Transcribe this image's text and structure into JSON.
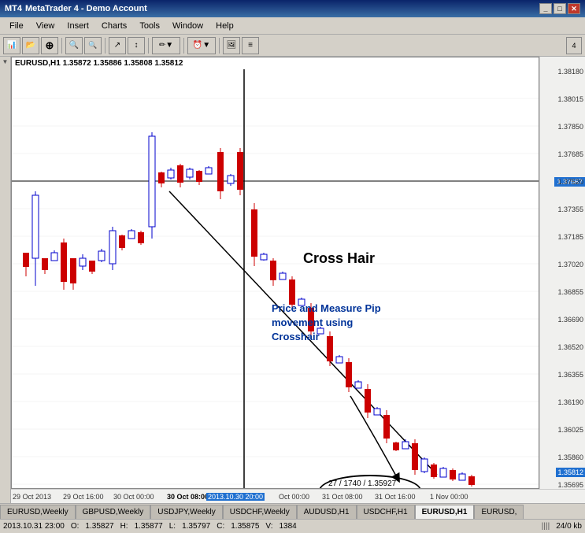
{
  "window": {
    "title": "MetaTrader 4 - Demo Account",
    "app_icon": "MT4"
  },
  "menu": {
    "items": [
      "File",
      "View",
      "Insert",
      "Charts",
      "Tools",
      "Window",
      "Help"
    ]
  },
  "toolbar": {
    "buttons": [
      "↩",
      "⊕",
      "🔍+",
      "🔍-",
      "→",
      "↕",
      "✏",
      "⏰",
      "🖼",
      "≡"
    ]
  },
  "chart": {
    "symbol_info": "EURUSD,H1  1.35872  1.35886  1.35808  1.35812",
    "price_levels": [
      "1.38180",
      "1.38015",
      "1.37850",
      "1.37685",
      "1.37520",
      "1.37355",
      "1.37185",
      "1.37020",
      "1.36855",
      "1.36690",
      "1.36520",
      "1.36355",
      "1.36190",
      "1.36025",
      "1.35860",
      "1.35695"
    ],
    "price_tag": "1.37667",
    "time_labels": [
      "29 Oct 2013",
      "29 Oct 16:00",
      "30 Oct 00:00",
      "30 Oct 08:00",
      "2013.10.30 20:00",
      "Oct 00:00",
      "31 Oct 08:00",
      "31 Oct 16:00",
      "1 Nov 00:00"
    ],
    "annotations": {
      "crosshair_label": "Cross Hair",
      "pip_label": "Price and Measure Pip\nmovement using\nCrosshair",
      "oval_text": "27 / 1740 / 1.35927"
    }
  },
  "symbol_tabs": {
    "tabs": [
      "EURUSD,Weekly",
      "GBPUSD,Weekly",
      "USDJPY,Weekly",
      "USDCHF,Weekly",
      "AUDUSD,H1",
      "USDCHF,H1",
      "EURUSD,H1",
      "EURUSD,"
    ],
    "active": 6
  },
  "status_bar": {
    "datetime": "2013.10.31 23:00",
    "open_label": "O:",
    "open_value": "1.35827",
    "high_label": "H:",
    "high_value": "1.35877",
    "low_label": "L:",
    "low_value": "1.35797",
    "close_label": "C:",
    "close_value": "1.35875",
    "volume_label": "V:",
    "volume_value": "1384",
    "bars": "24/0 kb",
    "spread_icon": "||||"
  }
}
